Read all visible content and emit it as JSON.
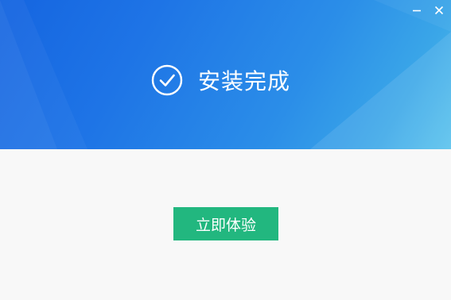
{
  "installer": {
    "title": "安装完成",
    "primary_button": "立即体验",
    "window_controls": {
      "minimize_icon": "minimize-icon",
      "close_icon": "close-icon"
    },
    "status_icon": "check-circle-icon"
  },
  "colors": {
    "header_start": "#1565e0",
    "header_end": "#58c2ec",
    "button": "#22b77f",
    "body_bg": "#f8f8f8"
  }
}
